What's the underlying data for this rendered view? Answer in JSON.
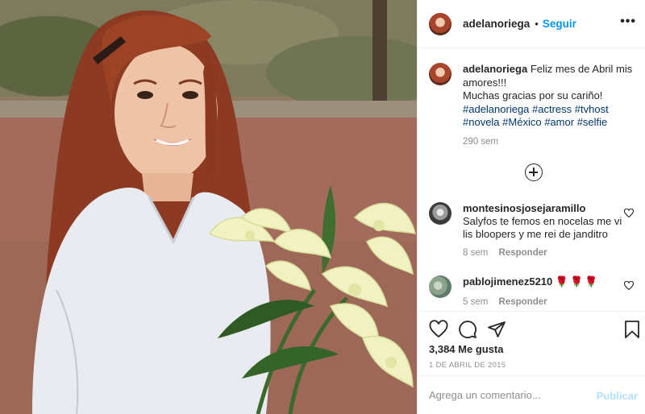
{
  "post": {
    "image_alt": "",
    "username": "adelanoriega",
    "follow_label": "Seguir",
    "dot": "•",
    "more_label": "•••"
  },
  "caption": {
    "username": "adelanoriega",
    "text_line1": "Feliz mes de Abril mis amores!!!",
    "text_line2": "Muchas gracias por su cariño!",
    "hashtags": [
      "#adelanoriega",
      "#actress",
      "#tvhost",
      "#novela",
      "#México",
      "#amor",
      "#selfie"
    ],
    "time": "290 sem"
  },
  "comments": [
    {
      "username": "montesinosjosejaramillo",
      "text": "Salyfos te femos en nocelas me vi lis bloopers y me rei de janditro",
      "time": "8 sem",
      "reply_label": "Responder"
    },
    {
      "username": "pablojimenez5210",
      "text": "🌹🌹🌹",
      "time": "5 sem",
      "reply_label": "Responder"
    }
  ],
  "stats": {
    "likes": "3,384 Me gusta",
    "date": "1 DE ABRIL DE 2015"
  },
  "composer": {
    "placeholder": "Agrega un comentario...",
    "publish_label": "Publicar"
  },
  "colors": {
    "accent": "#0095f6",
    "hashtag": "#00376b",
    "muted": "#8e8e8e",
    "publish_disabled": "#b2dffc"
  },
  "icons": [
    "more-options-icon",
    "load-more-comments-icon",
    "heart-icon",
    "comment-icon",
    "share-icon",
    "bookmark-icon"
  ]
}
